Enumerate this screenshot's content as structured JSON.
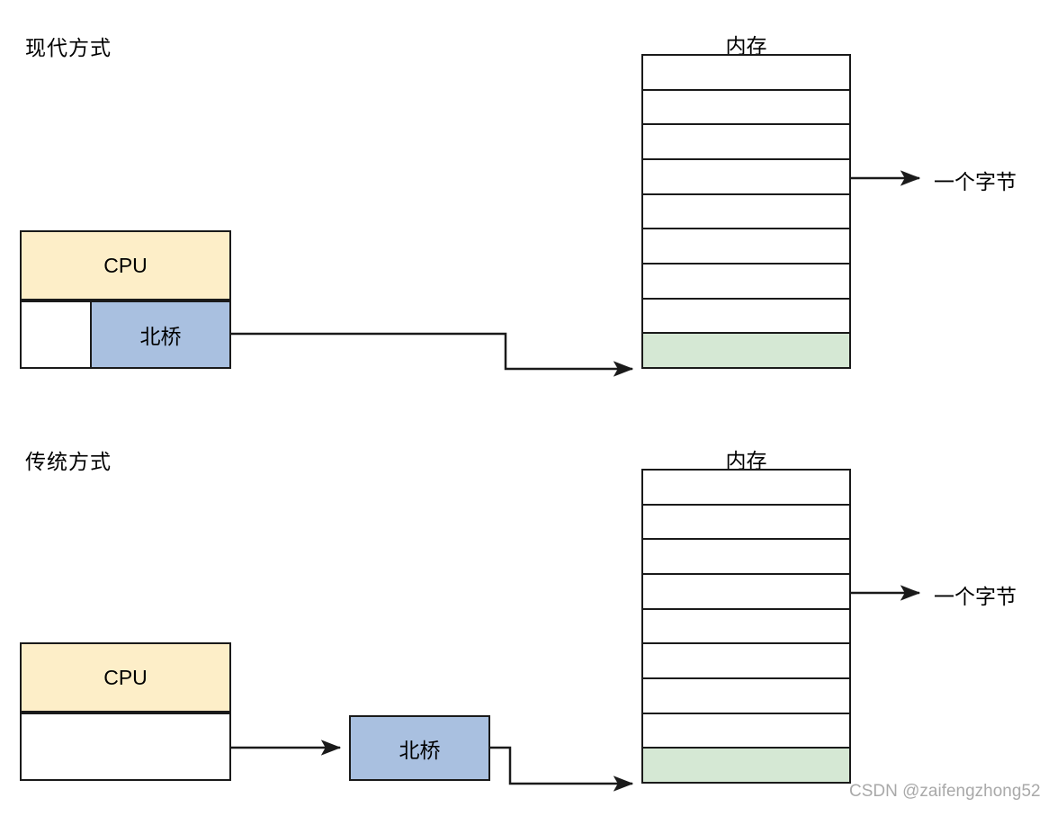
{
  "diagram": {
    "watermark": "CSDN @zaifengzhong52",
    "colors": {
      "cpu_fill": "#fdeec8",
      "bridge_fill": "#a9c0e0",
      "memory_highlight_fill": "#d5e8d4",
      "stroke": "#1a1a1a",
      "background": "#ffffff",
      "watermark_text": "#a9a9a9"
    },
    "sections": [
      {
        "id": "modern",
        "title": "现代方式",
        "cpu_label": "CPU",
        "bridge_label": "北桥",
        "memory_title": "内存",
        "byte_label": "一个字节",
        "memory_rows": 9,
        "memory_highlight_row_index": 8,
        "bridge_inside_cpu_package": true
      },
      {
        "id": "traditional",
        "title": "传统方式",
        "cpu_label": "CPU",
        "bridge_label": "北桥",
        "memory_title": "内存",
        "byte_label": "一个字节",
        "memory_rows": 9,
        "memory_highlight_row_index": 8,
        "bridge_inside_cpu_package": false
      }
    ]
  }
}
